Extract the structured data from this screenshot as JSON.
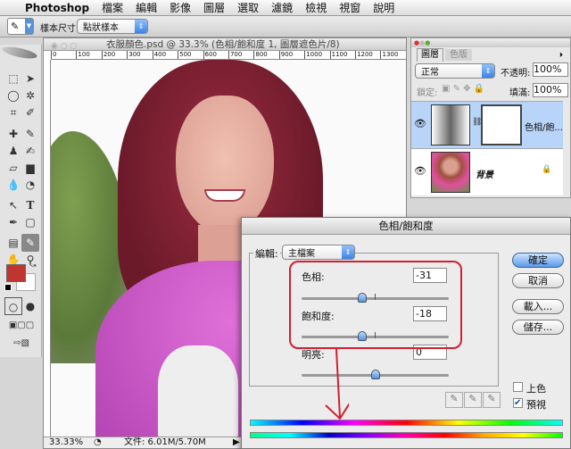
{
  "menubar": {
    "app": "Photoshop",
    "items": [
      "檔案",
      "編輯",
      "影像",
      "圖層",
      "選取",
      "濾鏡",
      "檢視",
      "視窗",
      "說明"
    ]
  },
  "options": {
    "sample_size_label": "樣本尺寸:",
    "sample_size_value": "點狀樣本"
  },
  "document": {
    "title": "衣服顏色.psd @ 33.3% (色相/飽和度 1, 圖層遮色片/8)",
    "ruler_ticks": [
      "0",
      "100",
      "200",
      "300",
      "400",
      "500",
      "600",
      "700",
      "800",
      "900",
      "1000",
      "1100",
      "1200",
      "1300"
    ],
    "zoom": "33.33%",
    "file_info": "文件: 6.01M/5.70M"
  },
  "tools": {
    "foreground": "#c0352f",
    "background": "#ffffff"
  },
  "layers": {
    "tabs": [
      "圖層",
      "色版"
    ],
    "blend_mode": "正常",
    "opacity_label": "不透明:",
    "opacity": "100%",
    "lock_label": "鎖定:",
    "fill_label": "填滿:",
    "fill": "100%",
    "items": [
      {
        "name": "色相/飽...",
        "selected": true
      },
      {
        "name": "背景",
        "selected": false
      }
    ]
  },
  "dialog": {
    "title": "色相/飽和度",
    "edit_label": "編輯:",
    "edit_value": "主檔案",
    "hue": {
      "label": "色相:",
      "value": "-31",
      "num": -31,
      "min": -180,
      "max": 180
    },
    "saturation": {
      "label": "飽和度:",
      "value": "-18",
      "num": -18,
      "min": -100,
      "max": 100
    },
    "lightness": {
      "label": "明亮:",
      "value": "0",
      "num": 0,
      "min": -100,
      "max": 100
    },
    "buttons": {
      "ok": "確定",
      "cancel": "取消",
      "load": "載入...",
      "save": "儲存..."
    },
    "colorize_label": "上色",
    "colorize": false,
    "preview_label": "預視",
    "preview": true
  },
  "annotation_color": "#d02030"
}
